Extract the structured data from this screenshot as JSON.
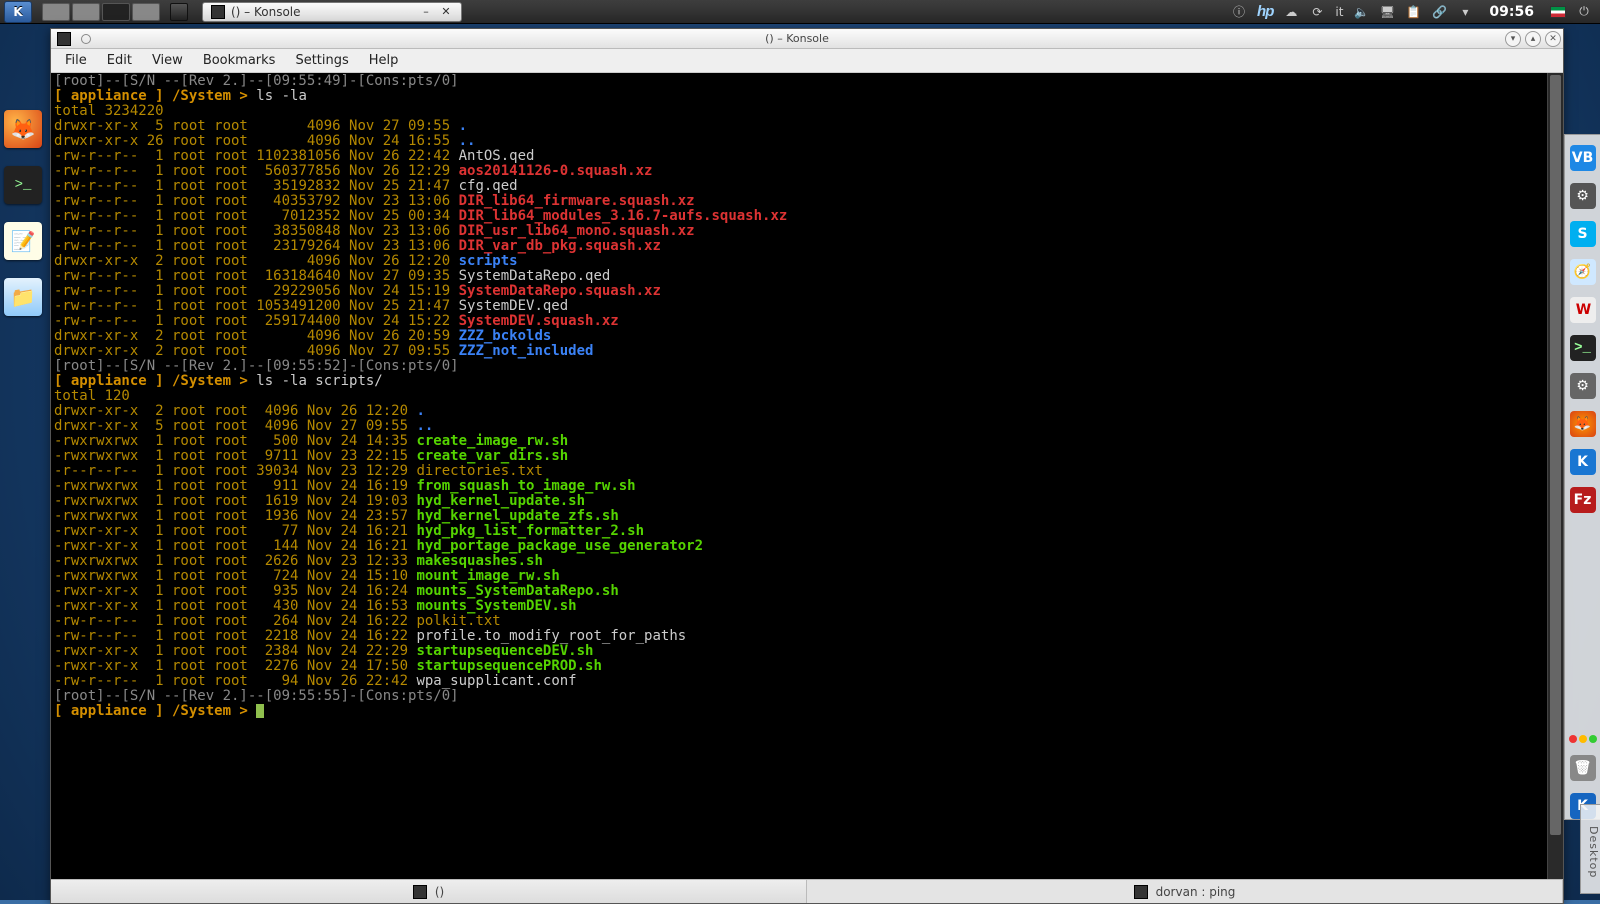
{
  "taskbar": {
    "kmenu_label": "K",
    "task_entry_title": "() – Konsole",
    "tray": {
      "lang": "it",
      "clock": "09:56",
      "hp": "hp"
    }
  },
  "left_dock": [
    "firefox",
    "terminal",
    "notes",
    "file-manager"
  ],
  "right_dock_letters": {
    "vb": "VB",
    "gear": "⚙",
    "sky": "S",
    "safari": "🧭",
    "w": "W",
    "term": ">_",
    "cog": "⚙",
    "ff": "🦊",
    "k": "K",
    "fz": "Fz",
    "trash": "🗑",
    "kde": "K"
  },
  "side_tab": "Desktop",
  "konsole": {
    "titlebar": "() – Konsole",
    "menus": [
      "File",
      "Edit",
      "View",
      "Bookmarks",
      "Settings",
      "Help"
    ],
    "tabs": [
      {
        "label": "()",
        "active": true
      },
      {
        "label": "dorvan : ping",
        "active": false
      }
    ],
    "status1": "[root]--[S/N --[Rev 2.]--[09:55:49]-[Cons:pts/0]",
    "status2": "[root]--[S/N --[Rev 2.]--[09:55:52]-[Cons:pts/0]",
    "status3": "[root]--[S/N --[Rev 2.]--[09:55:55]-[Cons:pts/0]",
    "prompt": "[ appliance ] /System > ",
    "cmd1": "ls -la",
    "cmd2": "ls -la scripts/",
    "total1": "total 3234220",
    "total2": "total 120",
    "ls1": [
      {
        "perm": "drwxr-xr-x",
        "l": "5",
        "o": "root",
        "g": "root",
        "sz": "      4096",
        "d": "Nov 27 09:55",
        "name": ".",
        "cls": "c-blu"
      },
      {
        "perm": "drwxr-xr-x",
        "l": "26",
        "o": "root",
        "g": "root",
        "sz": "      4096",
        "d": "Nov 24 16:55",
        "name": "..",
        "cls": "c-blu"
      },
      {
        "perm": "-rw-r--r--",
        "l": "1",
        "o": "root",
        "g": "root",
        "sz": "1102381056",
        "d": "Nov 26 22:42",
        "name": "AntOS.qed",
        "cls": "c-wht"
      },
      {
        "perm": "-rw-r--r--",
        "l": "1",
        "o": "root",
        "g": "root",
        "sz": " 560377856",
        "d": "Nov 26 12:29",
        "name": "aos20141126-0.squash.xz",
        "cls": "c-red"
      },
      {
        "perm": "-rw-r--r--",
        "l": "1",
        "o": "root",
        "g": "root",
        "sz": "  35192832",
        "d": "Nov 25 21:47",
        "name": "cfg.qed",
        "cls": "c-wht"
      },
      {
        "perm": "-rw-r--r--",
        "l": "1",
        "o": "root",
        "g": "root",
        "sz": "  40353792",
        "d": "Nov 23 13:06",
        "name": "DIR_lib64_firmware.squash.xz",
        "cls": "c-red"
      },
      {
        "perm": "-rw-r--r--",
        "l": "1",
        "o": "root",
        "g": "root",
        "sz": "   7012352",
        "d": "Nov 25 00:34",
        "name": "DIR_lib64_modules_3.16.7-aufs.squash.xz",
        "cls": "c-red"
      },
      {
        "perm": "-rw-r--r--",
        "l": "1",
        "o": "root",
        "g": "root",
        "sz": "  38350848",
        "d": "Nov 23 13:06",
        "name": "DIR_usr_lib64_mono.squash.xz",
        "cls": "c-red"
      },
      {
        "perm": "-rw-r--r--",
        "l": "1",
        "o": "root",
        "g": "root",
        "sz": "  23179264",
        "d": "Nov 23 13:06",
        "name": "DIR_var_db_pkg.squash.xz",
        "cls": "c-red"
      },
      {
        "perm": "drwxr-xr-x",
        "l": "2",
        "o": "root",
        "g": "root",
        "sz": "      4096",
        "d": "Nov 26 12:20",
        "name": "scripts",
        "cls": "c-blu"
      },
      {
        "perm": "-rw-r--r--",
        "l": "1",
        "o": "root",
        "g": "root",
        "sz": " 163184640",
        "d": "Nov 27 09:35",
        "name": "SystemDataRepo.qed",
        "cls": "c-wht"
      },
      {
        "perm": "-rw-r--r--",
        "l": "1",
        "o": "root",
        "g": "root",
        "sz": "  29229056",
        "d": "Nov 24 15:19",
        "name": "SystemDataRepo.squash.xz",
        "cls": "c-red"
      },
      {
        "perm": "-rw-r--r--",
        "l": "1",
        "o": "root",
        "g": "root",
        "sz": "1053491200",
        "d": "Nov 25 21:47",
        "name": "SystemDEV.qed",
        "cls": "c-wht"
      },
      {
        "perm": "-rw-r--r--",
        "l": "1",
        "o": "root",
        "g": "root",
        "sz": " 259174400",
        "d": "Nov 24 15:22",
        "name": "SystemDEV.squash.xz",
        "cls": "c-red"
      },
      {
        "perm": "drwxr-xr-x",
        "l": "2",
        "o": "root",
        "g": "root",
        "sz": "      4096",
        "d": "Nov 26 20:59",
        "name": "ZZZ_bckolds",
        "cls": "c-blu"
      },
      {
        "perm": "drwxr-xr-x",
        "l": "2",
        "o": "root",
        "g": "root",
        "sz": "      4096",
        "d": "Nov 27 09:55",
        "name": "ZZZ_not_included",
        "cls": "c-blu"
      }
    ],
    "ls2": [
      {
        "perm": "drwxr-xr-x",
        "l": "2",
        "o": "root",
        "g": "root",
        "sz": " 4096",
        "d": "Nov 26 12:20",
        "name": ".",
        "cls": "c-blu"
      },
      {
        "perm": "drwxr-xr-x",
        "l": "5",
        "o": "root",
        "g": "root",
        "sz": " 4096",
        "d": "Nov 27 09:55",
        "name": "..",
        "cls": "c-blu"
      },
      {
        "perm": "-rwxrwxrwx",
        "l": "1",
        "o": "root",
        "g": "root",
        "sz": "  500",
        "d": "Nov 24 14:35",
        "name": "create_image_rw.sh",
        "cls": "c-grn"
      },
      {
        "perm": "-rwxrwxrwx",
        "l": "1",
        "o": "root",
        "g": "root",
        "sz": " 9711",
        "d": "Nov 23 22:15",
        "name": "create_var_dirs.sh",
        "cls": "c-grn"
      },
      {
        "perm": "-r--r--r--",
        "l": "1",
        "o": "root",
        "g": "root",
        "sz": "39034",
        "d": "Nov 23 12:29",
        "name": "directories.txt",
        "cls": "c-ylw"
      },
      {
        "perm": "-rwxrwxrwx",
        "l": "1",
        "o": "root",
        "g": "root",
        "sz": "  911",
        "d": "Nov 24 16:19",
        "name": "from_squash_to_image_rw.sh",
        "cls": "c-grn"
      },
      {
        "perm": "-rwxrwxrwx",
        "l": "1",
        "o": "root",
        "g": "root",
        "sz": " 1619",
        "d": "Nov 24 19:03",
        "name": "hyd_kernel_update.sh",
        "cls": "c-grn"
      },
      {
        "perm": "-rwxrwxrwx",
        "l": "1",
        "o": "root",
        "g": "root",
        "sz": " 1936",
        "d": "Nov 24 23:57",
        "name": "hyd_kernel_update_zfs.sh",
        "cls": "c-grn"
      },
      {
        "perm": "-rwxr-xr-x",
        "l": "1",
        "o": "root",
        "g": "root",
        "sz": "   77",
        "d": "Nov 24 16:21",
        "name": "hyd_pkg_list_formatter_2.sh",
        "cls": "c-grn"
      },
      {
        "perm": "-rwxr-xr-x",
        "l": "1",
        "o": "root",
        "g": "root",
        "sz": "  144",
        "d": "Nov 24 16:21",
        "name": "hyd_portage_package_use_generator2",
        "cls": "c-grn"
      },
      {
        "perm": "-rwxrwxrwx",
        "l": "1",
        "o": "root",
        "g": "root",
        "sz": " 2626",
        "d": "Nov 23 12:33",
        "name": "makesquashes.sh",
        "cls": "c-grn"
      },
      {
        "perm": "-rwxrwxrwx",
        "l": "1",
        "o": "root",
        "g": "root",
        "sz": "  724",
        "d": "Nov 24 15:10",
        "name": "mount_image_rw.sh",
        "cls": "c-grn"
      },
      {
        "perm": "-rwxr-xr-x",
        "l": "1",
        "o": "root",
        "g": "root",
        "sz": "  935",
        "d": "Nov 24 16:24",
        "name": "mounts_SystemDataRepo.sh",
        "cls": "c-grn"
      },
      {
        "perm": "-rwxr-xr-x",
        "l": "1",
        "o": "root",
        "g": "root",
        "sz": "  430",
        "d": "Nov 24 16:53",
        "name": "mounts_SystemDEV.sh",
        "cls": "c-grn"
      },
      {
        "perm": "-rw-r--r--",
        "l": "1",
        "o": "root",
        "g": "root",
        "sz": "  264",
        "d": "Nov 24 16:22",
        "name": "polkit.txt",
        "cls": "c-ylw"
      },
      {
        "perm": "-rw-r--r--",
        "l": "1",
        "o": "root",
        "g": "root",
        "sz": " 2218",
        "d": "Nov 24 16:22",
        "name": "profile.to_modify_root_for_paths",
        "cls": "c-wht"
      },
      {
        "perm": "-rwxr-xr-x",
        "l": "1",
        "o": "root",
        "g": "root",
        "sz": " 2384",
        "d": "Nov 24 22:29",
        "name": "startupsequenceDEV.sh",
        "cls": "c-grn"
      },
      {
        "perm": "-rwxr-xr-x",
        "l": "1",
        "o": "root",
        "g": "root",
        "sz": " 2276",
        "d": "Nov 24 17:50",
        "name": "startupsequencePROD.sh",
        "cls": "c-grn"
      },
      {
        "perm": "-rw-r--r--",
        "l": "1",
        "o": "root",
        "g": "root",
        "sz": "   94",
        "d": "Nov 26 22:42",
        "name": "wpa_supplicant.conf",
        "cls": "c-wht"
      }
    ]
  }
}
